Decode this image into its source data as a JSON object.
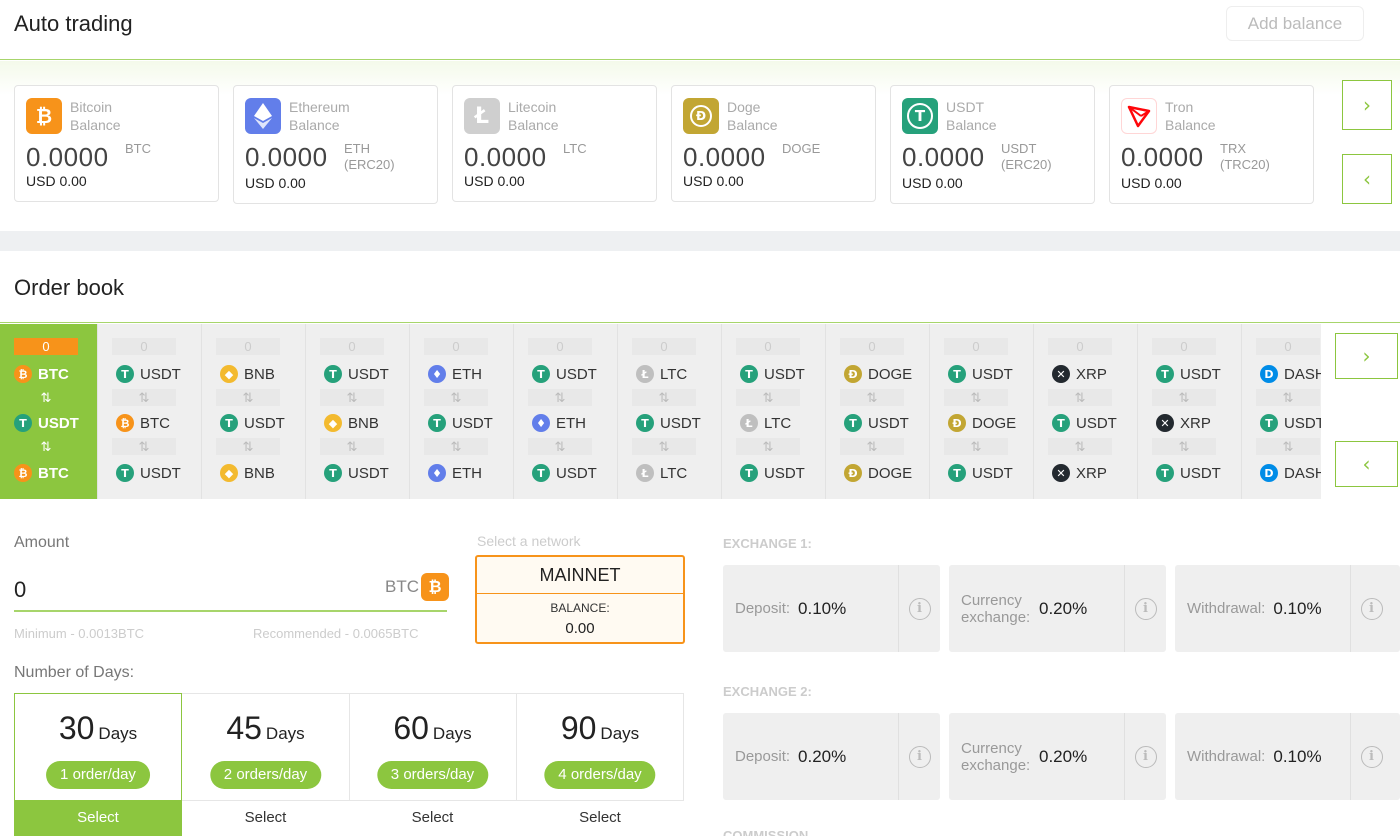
{
  "header": {
    "title": "Auto trading",
    "add_balance_label": "Add balance"
  },
  "balances": [
    {
      "name": "Bitcoin",
      "sub": "Balance",
      "amount": "0.0000",
      "unit": "BTC",
      "unit2": "",
      "usd": "USD 0.00",
      "icon": "bitcoin-icon",
      "color": "#f7931a"
    },
    {
      "name": "Ethereum",
      "sub": "Balance",
      "amount": "0.0000",
      "unit": "ETH",
      "unit2": "(ERC20)",
      "usd": "USD 0.00",
      "icon": "ethereum-icon",
      "color": "#627eea"
    },
    {
      "name": "Litecoin",
      "sub": "Balance",
      "amount": "0.0000",
      "unit": "LTC",
      "unit2": "",
      "usd": "USD 0.00",
      "icon": "litecoin-icon",
      "color": "#cfcfcf"
    },
    {
      "name": "Doge",
      "sub": "Balance",
      "amount": "0.0000",
      "unit": "DOGE",
      "unit2": "",
      "usd": "USD 0.00",
      "icon": "doge-icon",
      "color": "#c2a633"
    },
    {
      "name": "USDT",
      "sub": "Balance",
      "amount": "0.0000",
      "unit": "USDT",
      "unit2": "(ERC20)",
      "usd": "USD 0.00",
      "icon": "usdt-icon",
      "color": "#26a17b"
    },
    {
      "name": "Tron",
      "sub": "Balance",
      "amount": "0.0000",
      "unit": "TRX",
      "unit2": "(TRC20)",
      "usd": "USD 0.00",
      "icon": "tron-icon",
      "color": "#ff060a"
    }
  ],
  "nav": {
    "next": "›",
    "prev": "‹"
  },
  "order_book": {
    "title": "Order book",
    "swap_glyph": "⇅",
    "columns": [
      {
        "count": "0",
        "pair": [
          "BTC",
          "USDT",
          "BTC"
        ],
        "active": true
      },
      {
        "count": "0",
        "pair": [
          "USDT",
          "BTC",
          "USDT"
        ]
      },
      {
        "count": "0",
        "pair": [
          "BNB",
          "USDT",
          "BNB"
        ]
      },
      {
        "count": "0",
        "pair": [
          "USDT",
          "BNB",
          "USDT"
        ]
      },
      {
        "count": "0",
        "pair": [
          "ETH",
          "USDT",
          "ETH"
        ]
      },
      {
        "count": "0",
        "pair": [
          "USDT",
          "ETH",
          "USDT"
        ]
      },
      {
        "count": "0",
        "pair": [
          "LTC",
          "USDT",
          "LTC"
        ]
      },
      {
        "count": "0",
        "pair": [
          "USDT",
          "LTC",
          "USDT"
        ]
      },
      {
        "count": "0",
        "pair": [
          "DOGE",
          "USDT",
          "DOGE"
        ]
      },
      {
        "count": "0",
        "pair": [
          "USDT",
          "DOGE",
          "USDT"
        ]
      },
      {
        "count": "0",
        "pair": [
          "XRP",
          "USDT",
          "XRP"
        ]
      },
      {
        "count": "0",
        "pair": [
          "USDT",
          "XRP",
          "USDT"
        ]
      },
      {
        "count": "0",
        "pair": [
          "DASH",
          "USDT",
          "DASH"
        ]
      }
    ]
  },
  "amount": {
    "label": "Amount",
    "value": "0",
    "unit": "BTC",
    "minimum": "Minimum - 0.0013BTC",
    "recommended": "Recommended - 0.0065BTC"
  },
  "network": {
    "label": "Select a network",
    "name": "MAINNET",
    "balance_label": "BALANCE:",
    "balance": "0.00"
  },
  "days": {
    "label": "Number of Days:",
    "options": [
      {
        "num": "30",
        "unit": "Days",
        "orders": "1 order/day",
        "select": "Select",
        "selected": true
      },
      {
        "num": "45",
        "unit": "Days",
        "orders": "2 orders/day",
        "select": "Select"
      },
      {
        "num": "60",
        "unit": "Days",
        "orders": "3 orders/day",
        "select": "Select"
      },
      {
        "num": "90",
        "unit": "Days",
        "orders": "4 orders/day",
        "select": "Select"
      }
    ]
  },
  "exchanges": [
    {
      "label": "EXCHANGE 1:",
      "fees": [
        {
          "name": "Deposit:",
          "value": "0.10%"
        },
        {
          "name": "Currency exchange:",
          "value": "0.20%"
        },
        {
          "name": "Withdrawal:",
          "value": "0.10%"
        }
      ]
    },
    {
      "label": "EXCHANGE 2:",
      "fees": [
        {
          "name": "Deposit:",
          "value": "0.20%"
        },
        {
          "name": "Currency exchange:",
          "value": "0.20%"
        },
        {
          "name": "Withdrawal:",
          "value": "0.10%"
        }
      ]
    }
  ],
  "commission_label": "COMMISSION",
  "info_glyph": "i",
  "colors": {
    "accent": "#8cc63f",
    "btc": "#f7931a"
  }
}
